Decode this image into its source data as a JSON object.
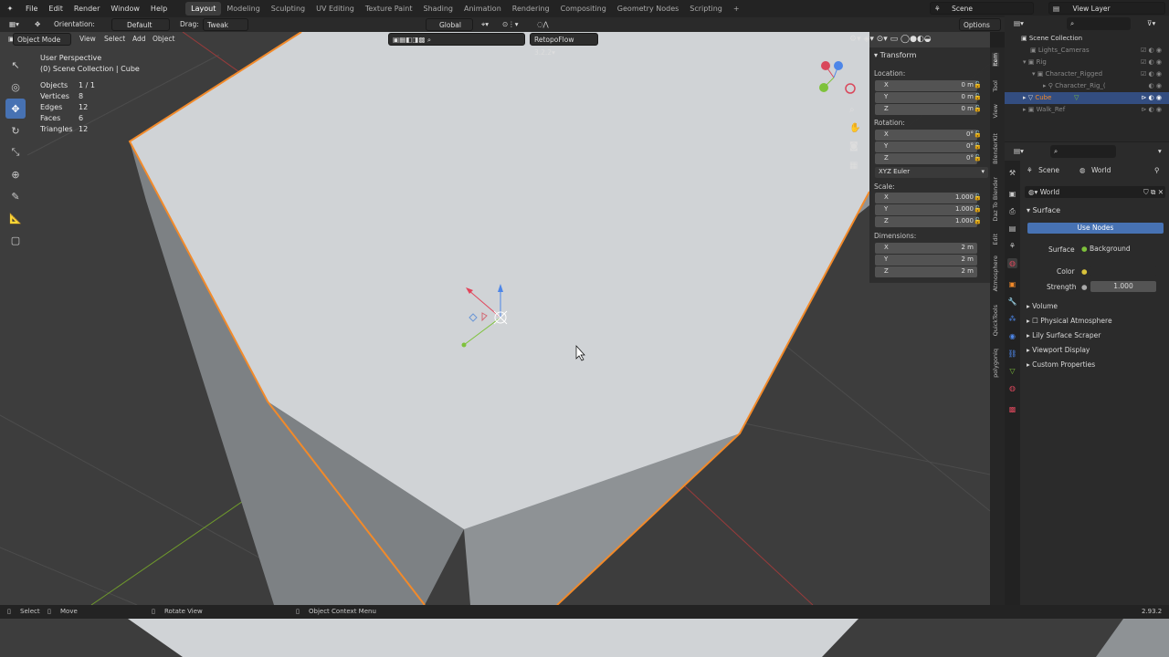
{
  "topbar": {
    "menus": [
      "File",
      "Edit",
      "Render",
      "Window",
      "Help"
    ],
    "workspaces": [
      "Layout",
      "Modeling",
      "Sculpting",
      "UV Editing",
      "Texture Paint",
      "Shading",
      "Animation",
      "Rendering",
      "Compositing",
      "Geometry Nodes",
      "Scripting"
    ],
    "active_workspace": "Layout",
    "scene": "Scene",
    "view_layer": "View Layer"
  },
  "toolheader": {
    "orientation_label": "Orientation:",
    "orientation_value": "Default",
    "drag_label": "Drag:",
    "drag_value": "Tweak",
    "transform_orientation": "Global",
    "options": "Options"
  },
  "vpheader": {
    "mode": "Object Mode",
    "menus": [
      "View",
      "Select",
      "Add",
      "Object"
    ],
    "addon": "RetopoFlow 3.2.2"
  },
  "overlay": {
    "view_name": "User Perspective",
    "collection": "(0) Scene Collection | Cube",
    "stats": [
      {
        "label": "Objects",
        "value": "1 / 1"
      },
      {
        "label": "Vertices",
        "value": "8"
      },
      {
        "label": "Edges",
        "value": "12"
      },
      {
        "label": "Faces",
        "value": "6"
      },
      {
        "label": "Triangles",
        "value": "12"
      }
    ]
  },
  "npanel": {
    "title": "Transform",
    "location_label": "Location:",
    "location": [
      {
        "axis": "X",
        "value": "0 m"
      },
      {
        "axis": "Y",
        "value": "0 m"
      },
      {
        "axis": "Z",
        "value": "0 m"
      }
    ],
    "rotation_label": "Rotation:",
    "rotation": [
      {
        "axis": "X",
        "value": "0°"
      },
      {
        "axis": "Y",
        "value": "0°"
      },
      {
        "axis": "Z",
        "value": "0°"
      }
    ],
    "rotation_mode": "XYZ Euler",
    "scale_label": "Scale:",
    "scale": [
      {
        "axis": "X",
        "value": "1.000"
      },
      {
        "axis": "Y",
        "value": "1.000"
      },
      {
        "axis": "Z",
        "value": "1.000"
      }
    ],
    "dimensions_label": "Dimensions:",
    "dimensions": [
      {
        "axis": "X",
        "value": "2 m"
      },
      {
        "axis": "Y",
        "value": "2 m"
      },
      {
        "axis": "Z",
        "value": "2 m"
      }
    ]
  },
  "sidetabs": [
    "Item",
    "Tool",
    "View",
    "BlenderKit",
    "Daz To Blender",
    "Edit",
    "Atmosphere",
    "QuickTools",
    "polygoniq"
  ],
  "outliner": {
    "root": "Scene Collection",
    "rows": [
      "Lights_Cameras",
      "Rig",
      "Character_Rigged",
      "Character_Rig_(",
      "Cube",
      "Walk_Ref"
    ]
  },
  "properties": {
    "scene_tab": "Scene",
    "world_tab": "World",
    "world_name": "World",
    "surface_header": "Surface",
    "use_nodes": "Use Nodes",
    "surface_label": "Surface",
    "surface_value": "Background",
    "color_label": "Color",
    "strength_label": "Strength",
    "strength_value": "1.000",
    "panels": [
      "Volume",
      "Physical Atmosphere",
      "Lily Surface Scraper",
      "Viewport Display",
      "Custom Properties"
    ]
  },
  "statusbar": {
    "select": "Select",
    "move": "Move",
    "rotate": "Rotate View",
    "context": "Object Context Menu",
    "version": "2.93.2"
  },
  "colors": {
    "accent": "#4772b3",
    "selection_outline": "#f28a2a",
    "cube_top": "#d4d7da",
    "cube_side": "#8c9093"
  }
}
